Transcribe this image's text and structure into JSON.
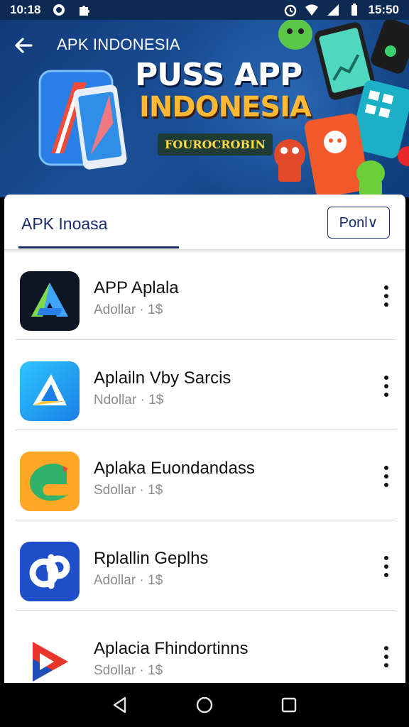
{
  "status_bar": {
    "left_time": "10:18",
    "right_time": "15:50"
  },
  "header": {
    "title": "APK INDONESIA",
    "banner_line1": "PUSS APP",
    "banner_line2": "INDONESIA",
    "banner_badge": "FOUROCROBIN"
  },
  "tab": {
    "label": "APK Inoasa",
    "filter_label": "Ponl∨"
  },
  "apps": [
    {
      "title": "APP Aplala",
      "subtitle": "Adollar · 1$",
      "icon": "a-logo-icon"
    },
    {
      "title": "Aplailn Vby Sarcis",
      "subtitle": "Ndollar · 1$",
      "icon": "triangle-logo-icon"
    },
    {
      "title": "Aplaka Euondandass",
      "subtitle": "Sdollar · 1$",
      "icon": "swirl-logo-icon"
    },
    {
      "title": "Rplallin Geplhs",
      "subtitle": "Adollar · 1$",
      "icon": "cp-logo-icon"
    },
    {
      "title": "Aplacia Fhindortinns",
      "subtitle": "Sdollar · 1$",
      "icon": "play-logo-icon"
    }
  ],
  "colors": {
    "accent": "#1a2c6b",
    "banner": "#123a78",
    "highlight": "#ffb935"
  }
}
